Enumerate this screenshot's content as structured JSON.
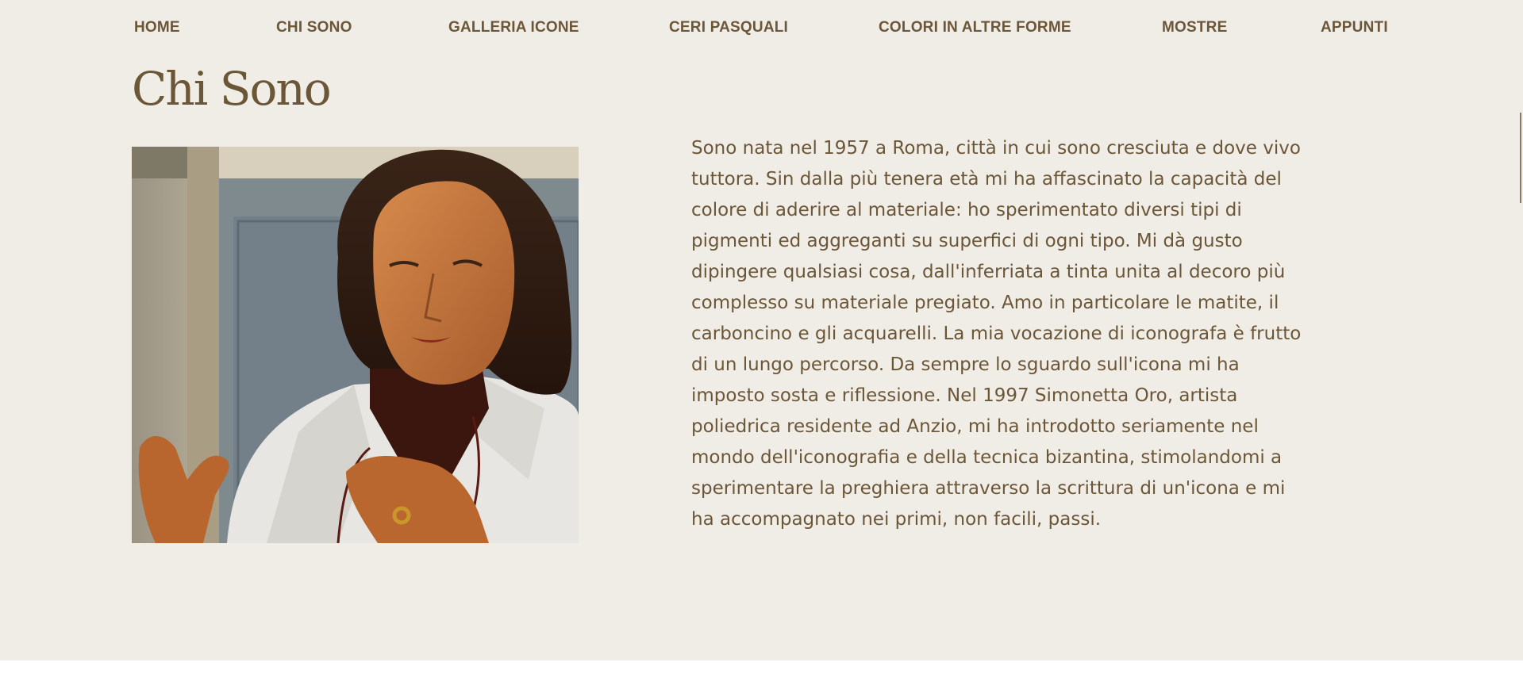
{
  "nav": {
    "items": [
      {
        "label": "HOME"
      },
      {
        "label": "CHI SONO"
      },
      {
        "label": "GALLERIA ICONE"
      },
      {
        "label": "CERI PASQUALI"
      },
      {
        "label": "COLORI IN ALTRE FORME"
      },
      {
        "label": "MOSTRE"
      },
      {
        "label": "APPUNTI"
      }
    ]
  },
  "page": {
    "title": "Chi Sono",
    "bio": "Sono nata nel 1957 a Roma, città in cui sono cresciuta e dove vivo tuttora. Sin dalla più tenera età mi ha affascinato la capacità del colore di aderire al materiale: ho sperimentato diversi tipi di pigmenti ed aggreganti su superfici di ogni tipo. Mi dà gusto dipingere qualsiasi cosa, dall'inferriata a tinta unita al decoro più complesso su materiale pregiato. Amo in particolare le matite, il carboncino e gli acquarelli. La mia vocazione di iconografa è frutto di un lungo percorso. Da sempre lo sguardo sull'icona mi ha imposto sosta e riflessione. Nel 1997 Simonetta Oro, artista poliedrica residente ad Anzio, mi ha introdotto seriamente nel mondo dell'iconografia e della tecnica bizantina, stimolandomi a sperimentare la preghiera attraverso la scrittura di un'icona e mi ha accompagnato nei primi, non facili, passi."
  },
  "colors": {
    "background": "#f0ede6",
    "text": "#6b5638",
    "footer": "#ffffff"
  }
}
